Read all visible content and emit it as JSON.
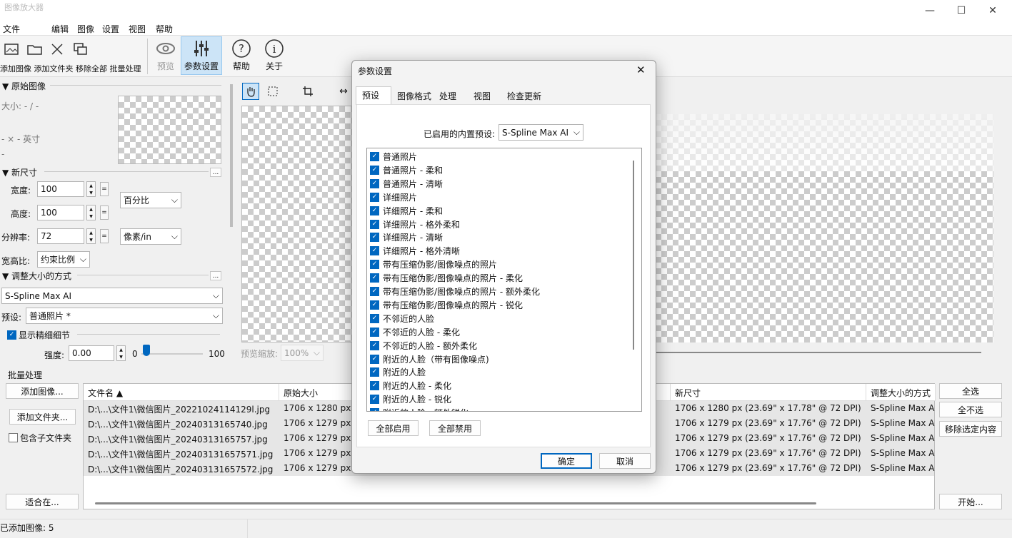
{
  "window": {
    "title": "图像放大器",
    "min": "—",
    "max": "☐",
    "close": "✕"
  },
  "menu": [
    "文件",
    "编辑",
    "图像",
    "设置",
    "视图",
    "帮助"
  ],
  "toolbar": {
    "group_label": "添加图像 添加文件夹 移除全部 批量处理",
    "preview": "预览",
    "params": "参数设置",
    "help": "帮助",
    "about": "关于"
  },
  "left": {
    "original_image": "原始图像",
    "size": "大小: - / -",
    "dims": "- × - 英寸",
    "dash": "-",
    "new_size": "新尺寸",
    "width_label": "宽度:",
    "width_value": "100",
    "height_label": "高度:",
    "height_value": "100",
    "resolution_label": "分辨率:",
    "resolution_value": "72",
    "unit_percent": "百分比",
    "unit_resolution": "像素/in",
    "aspect_label": "宽高比:",
    "aspect_value": "约束比例",
    "resize_method": "调整大小的方式",
    "method_value": "S-Spline Max AI",
    "preset_label": "预设:",
    "preset_value": "普通照片 *",
    "show_details": "显示精细细节",
    "strength_label": "强度:",
    "strength_value": "0.00",
    "slider_min": "0",
    "slider_max": "100",
    "more": "..."
  },
  "preview": {
    "zoom_label": "预览缩放:",
    "zoom_value": "100%"
  },
  "batch": {
    "title": "批量处理",
    "add_images": "添加图像...",
    "add_folder": "添加文件夹...",
    "include_subfolders": "包含子文件夹",
    "fit": "适合在...",
    "select_all": "全选",
    "select_none": "全不选",
    "remove_selected": "移除选定内容",
    "start": "开始..."
  },
  "table": {
    "headers": [
      "文件名 ▲",
      "原始大小",
      "",
      "新尺寸",
      "调整大小的方式"
    ],
    "rows": [
      {
        "name": "D:\\...\\文件1\\微信图片_20221024114129l.jpg",
        "orig": "1706 x 1280 px (",
        "new": "1706 x 1280 px (23.69\" x 17.78\" @ 72 DPI)",
        "method": "S-Spline Max AI"
      },
      {
        "name": "D:\\...\\文件1\\微信图片_20240313165740.jpg",
        "orig": "1706 x 1279 px (",
        "new": "1706 x 1279 px (23.69\" x 17.76\" @ 72 DPI)",
        "method": "S-Spline Max AI"
      },
      {
        "name": "D:\\...\\文件1\\微信图片_20240313165757.jpg",
        "orig": "1706 x 1279 px (",
        "new": "1706 x 1279 px (23.69\" x 17.76\" @ 72 DPI)",
        "method": "S-Spline Max AI"
      },
      {
        "name": "D:\\...\\文件1\\微信图片_202403131657571.jpg",
        "orig": "1706 x 1279 px (",
        "new": "1706 x 1279 px (23.69\" x 17.76\" @ 72 DPI)",
        "method": "S-Spline Max AI"
      },
      {
        "name": "D:\\...\\文件1\\微信图片_202403131657572.jpg",
        "orig": "1706 x 1279 px (",
        "new": "1706 x 1279 px (23.69\" x 17.76\" @ 72 DPI)",
        "method": "S-Spline Max AI"
      }
    ]
  },
  "status": {
    "added": "已添加图像: 5"
  },
  "dialog": {
    "title": "参数设置",
    "close": "✕",
    "tabs": [
      "预设",
      "图像格式",
      "处理",
      "视图",
      "检查更新"
    ],
    "builtin_label": "已启用的内置预设:",
    "builtin_value": "S-Spline Max AI",
    "presets": [
      "普通照片",
      "普通照片 - 柔和",
      "普通照片 - 清晰",
      "详细照片",
      "详细照片 - 柔和",
      "详细照片 - 格外柔和",
      "详细照片 - 清晰",
      "详细照片 - 格外清晰",
      "带有压缩伪影/图像噪点的照片",
      "带有压缩伪影/图像噪点的照片 - 柔化",
      "带有压缩伪影/图像噪点的照片 - 额外柔化",
      "带有压缩伪影/图像噪点的照片 - 锐化",
      "不邻近的人脸",
      "不邻近的人脸 - 柔化",
      "不邻近的人脸 - 额外柔化",
      "附近的人脸（带有图像噪点)",
      "附近的人脸",
      "附近的人脸 - 柔化",
      "附近的人脸 - 锐化",
      "附近的人脸 - 额外锐化"
    ],
    "enable_all": "全部启用",
    "disable_all": "全部禁用",
    "ok": "确定",
    "cancel": "取消"
  }
}
